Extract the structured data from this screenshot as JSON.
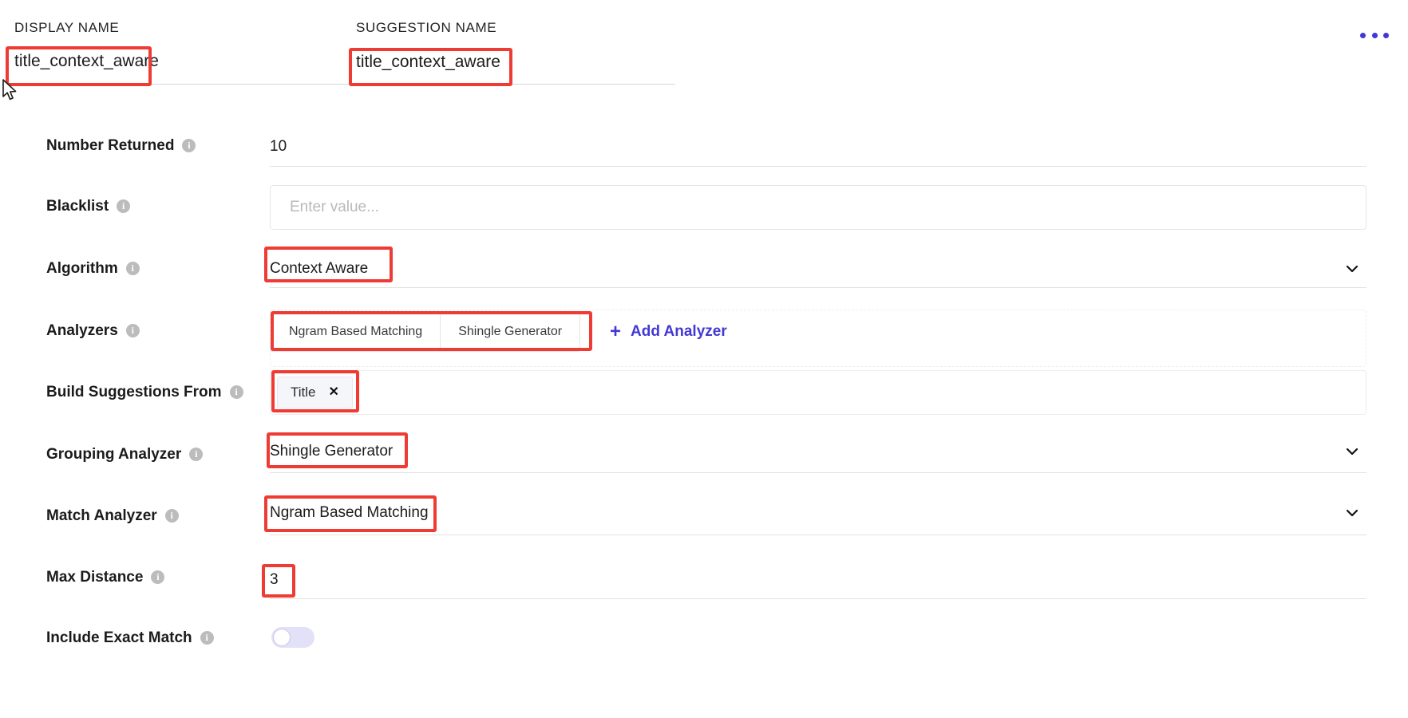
{
  "header": {
    "display_name_label": "DISPLAY NAME",
    "display_name_value": "title_context_aware",
    "suggestion_name_label": "SUGGESTION NAME",
    "suggestion_name_value": "title_context_aware",
    "overflow_menu_icon": "ellipsis-horizontal-icon"
  },
  "colors": {
    "accent": "#4338d4",
    "annotation": "#ee3b33",
    "toggle_track": "#e3e1f7",
    "info_icon": "#bcbcbc"
  },
  "icons": {
    "info": "i",
    "plus": "+",
    "chevron_down": "chevron-down-icon",
    "chip_remove": "✕"
  },
  "rows": [
    {
      "label": "Number Returned",
      "type": "text",
      "value": "10"
    },
    {
      "label": "Blacklist",
      "type": "input",
      "value": "",
      "placeholder": "Enter value..."
    },
    {
      "label": "Algorithm",
      "type": "select",
      "value": "Context Aware"
    },
    {
      "label": "Analyzers",
      "type": "tabs",
      "tabs": [
        "Ngram Based Matching",
        "Shingle Generator"
      ],
      "add_label": "Add Analyzer"
    },
    {
      "label": "Build Suggestions From",
      "type": "chips",
      "chips": [
        "Title"
      ]
    },
    {
      "label": "Grouping Analyzer",
      "type": "select",
      "value": "Shingle Generator"
    },
    {
      "label": "Match Analyzer",
      "type": "select",
      "value": "Ngram Based Matching"
    },
    {
      "label": "Max Distance",
      "type": "text",
      "value": "3"
    },
    {
      "label": "Include Exact Match",
      "type": "toggle",
      "value": "off"
    }
  ]
}
